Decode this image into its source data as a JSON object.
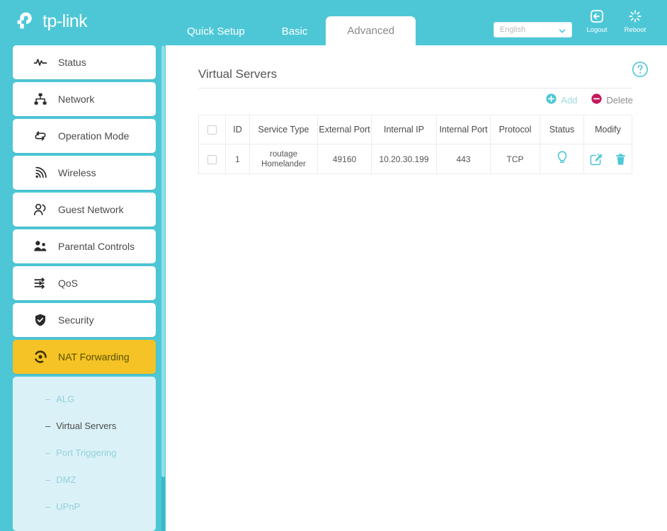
{
  "brand": {
    "name": "tp-link",
    "logo_icon": "tplink-logo-icon",
    "header_color": "#4DC7D6"
  },
  "header": {
    "tabs": [
      {
        "label": "Quick Setup",
        "active": false
      },
      {
        "label": "Basic",
        "active": false
      },
      {
        "label": "Advanced",
        "active": true
      }
    ],
    "language": {
      "selected": "English",
      "options": [
        "English"
      ],
      "chevron_icon": "chevron-down-icon"
    },
    "logout": {
      "label": "Logout",
      "icon": "logout-icon"
    },
    "reboot": {
      "label": "Reboot",
      "icon": "reboot-icon"
    }
  },
  "sidebar": {
    "items": [
      {
        "label": "Status",
        "icon": "pulse-icon",
        "active": false
      },
      {
        "label": "Network",
        "icon": "network-tree-icon",
        "active": false
      },
      {
        "label": "Operation Mode",
        "icon": "swap-arrows-icon",
        "active": false
      },
      {
        "label": "Wireless",
        "icon": "wifi-signal-icon",
        "active": false
      },
      {
        "label": "Guest Network",
        "icon": "guest-user-icon",
        "active": false
      },
      {
        "label": "Parental Controls",
        "icon": "parental-users-icon",
        "active": false
      },
      {
        "label": "QoS",
        "icon": "qos-arrows-icon",
        "active": false
      },
      {
        "label": "Security",
        "icon": "shield-icon",
        "active": false
      },
      {
        "label": "NAT Forwarding",
        "icon": "nat-refresh-icon",
        "active": true
      }
    ],
    "submenu": [
      {
        "label": "ALG",
        "active": false
      },
      {
        "label": "Virtual Servers",
        "active": true
      },
      {
        "label": "Port Triggering",
        "active": false
      },
      {
        "label": "DMZ",
        "active": false
      },
      {
        "label": "UPnP",
        "active": false
      }
    ],
    "active_color": "#F5C325",
    "submenu_bg": "#DAF2F7"
  },
  "main": {
    "panel_title": "Virtual Servers",
    "help_icon": "help-question-icon",
    "actions": {
      "add": {
        "label": "Add",
        "icon": "add-circle-icon",
        "color": "#4DC7D6"
      },
      "delete": {
        "label": "Delete",
        "icon": "delete-circle-icon",
        "color": "#C2185B"
      }
    },
    "table": {
      "select_all_checkbox": false,
      "columns": [
        "ID",
        "Service Type",
        "External Port",
        "Internal IP",
        "Internal Port",
        "Protocol",
        "Status",
        "Modify"
      ],
      "rows": [
        {
          "selected": false,
          "id": "1",
          "service_type": "routage Homelander",
          "external_port": "49160",
          "internal_ip": "10.20.30.199",
          "internal_port": "443",
          "protocol": "TCP",
          "status_icon": "lightbulb-icon",
          "edit_icon": "edit-square-icon",
          "delete_icon": "trash-icon"
        }
      ]
    }
  }
}
